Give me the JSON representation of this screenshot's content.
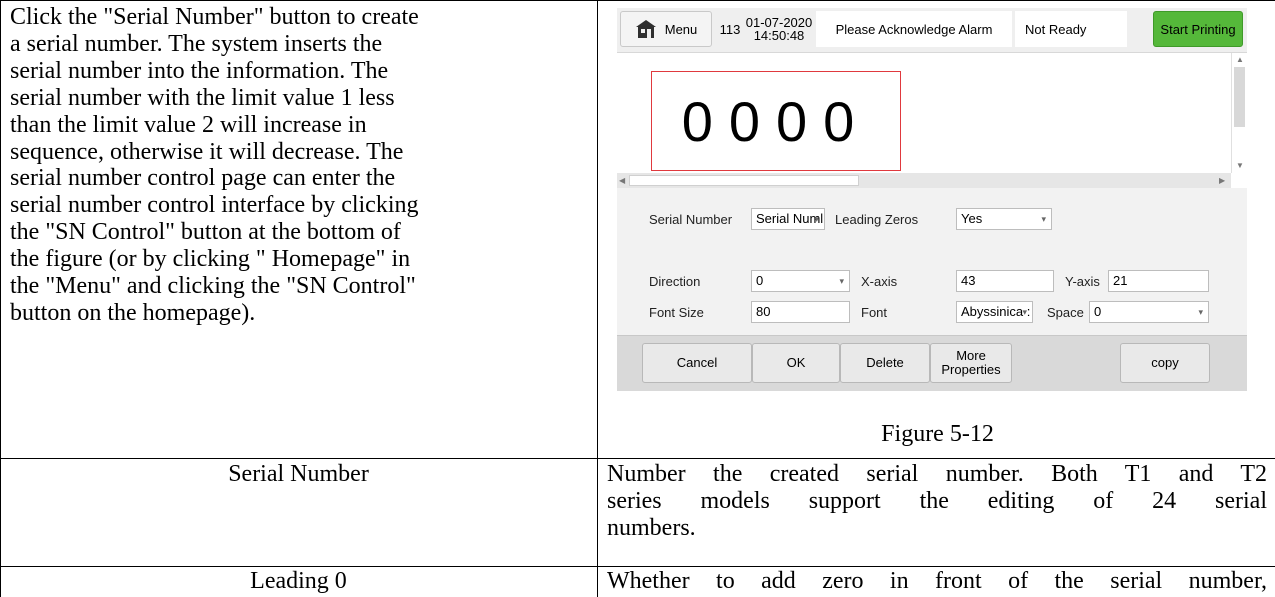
{
  "intro_paragraph": [
    "Click the \"Serial Number\" button to create",
    "a serial number. The system inserts the",
    "serial number into the information. The",
    "serial number with the limit value 1 less",
    "than the limit value 2 will increase in",
    "sequence, otherwise it will decrease. The",
    "serial number control page can enter the",
    "serial number control interface by clicking",
    "the \"SN Control\" button at the bottom of",
    "the figure (or by clicking \" Homepage\" in",
    "the \"Menu\" and clicking the \"SN Control\"",
    "button on the homepage)."
  ],
  "screenshot": {
    "top_bar": {
      "menu_label": "Menu",
      "count": "113",
      "date": "01-07-2020",
      "time": "14:50:48",
      "alarm": "Please Acknowledge Alarm",
      "status": "Not Ready",
      "start_label": "Start Printing"
    },
    "preview_text": "0000",
    "params": {
      "serial_number_label": "Serial Number",
      "serial_number_value": "Serial Numl",
      "leading_zeros_label": "Leading Zeros",
      "leading_zeros_value": "Yes",
      "direction_label": "Direction",
      "direction_value": "0",
      "x_axis_label": "X-axis",
      "x_axis_value": "43",
      "y_axis_label": "Y-axis",
      "y_axis_value": "21",
      "font_size_label": "Font Size",
      "font_size_value": "80",
      "font_label": "Font",
      "font_value": "Abyssinica :",
      "space_label": "Space",
      "space_value": "0"
    },
    "buttons": {
      "cancel": "Cancel",
      "ok": "OK",
      "delete": "Delete",
      "more_line1": "More",
      "more_line2": "Properties",
      "copy": "copy"
    },
    "accent_green": "#55b83a",
    "border_red": "#e0393e"
  },
  "figure_caption": "Figure 5-12",
  "rows": [
    {
      "label": "Serial Number",
      "description_lines": [
        "Number the created serial number. Both T1 and T2",
        "series models support the editing of 24 serial",
        "numbers."
      ]
    },
    {
      "label": "Leading 0",
      "description_lines": [
        "Whether to add zero in front of the serial number,"
      ]
    }
  ]
}
